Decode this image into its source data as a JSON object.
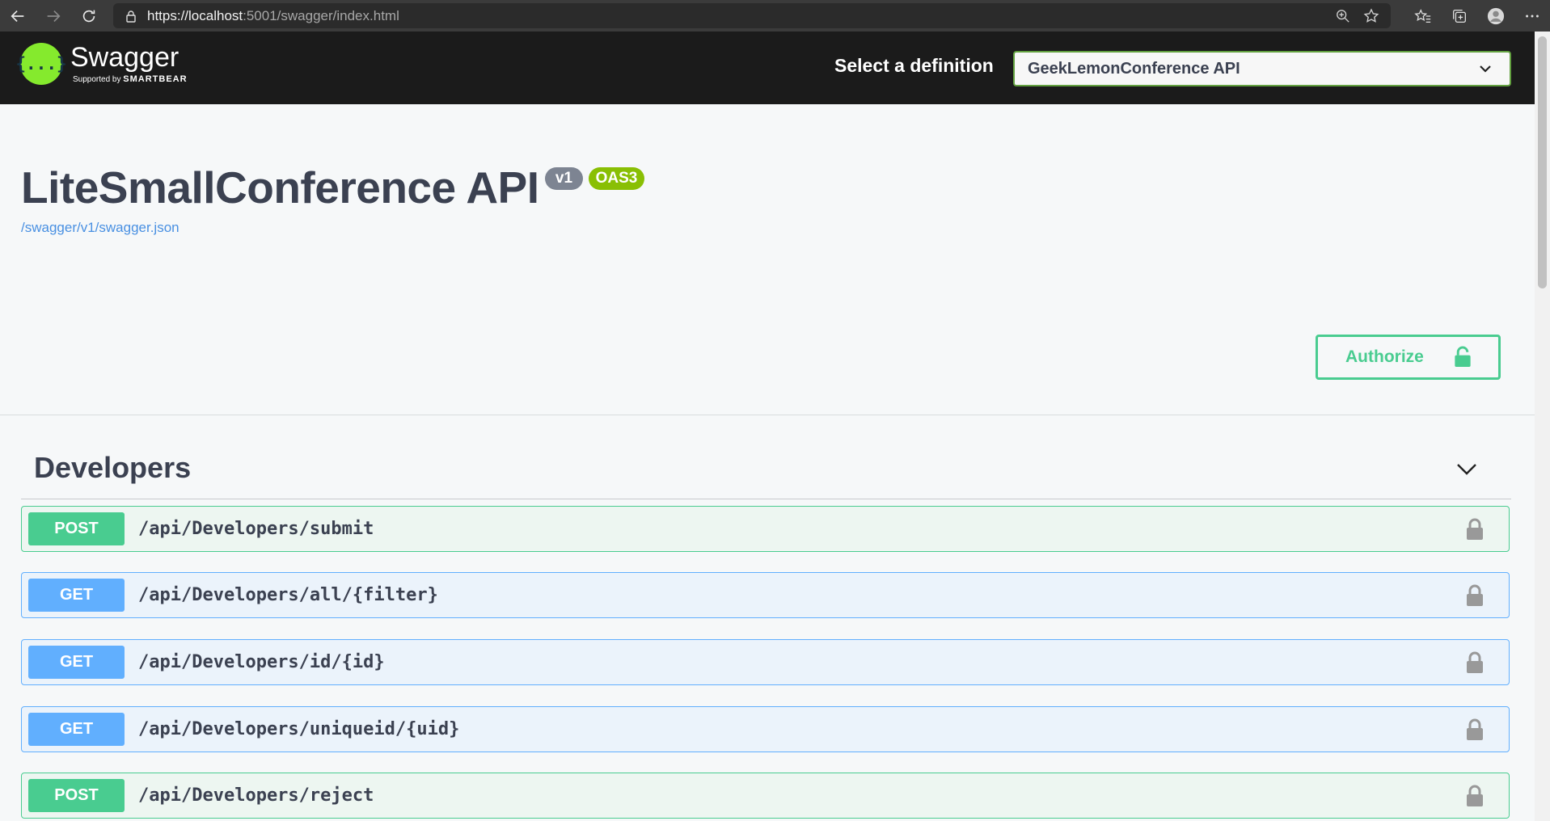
{
  "browser": {
    "url_main": "https://localhost",
    "url_rest": ":5001/swagger/index.html"
  },
  "topbar": {
    "logo_title": "Swagger",
    "logo_sub_prefix": "Supported by",
    "logo_sub_brand": "SMARTBEAR",
    "logo_glyph": "{...}",
    "select_label": "Select a definition",
    "select_value": "GeekLemonConference API"
  },
  "info": {
    "title": "LiteSmallConference API",
    "version_badge": "v1",
    "oas_badge": "OAS3",
    "spec_link": "/swagger/v1/swagger.json"
  },
  "authorize": {
    "label": "Authorize"
  },
  "tag": {
    "title": "Developers"
  },
  "operations": [
    {
      "method": "POST",
      "path": "/api/Developers/submit"
    },
    {
      "method": "GET",
      "path": "/api/Developers/all/{filter}"
    },
    {
      "method": "GET",
      "path": "/api/Developers/id/{id}"
    },
    {
      "method": "GET",
      "path": "/api/Developers/uniqueid/{uid}"
    },
    {
      "method": "POST",
      "path": "/api/Developers/reject"
    }
  ],
  "colors": {
    "post": "#49cc90",
    "get": "#61affe",
    "swagger_green": "#85ea2d",
    "topbar": "#1b1b1b"
  }
}
